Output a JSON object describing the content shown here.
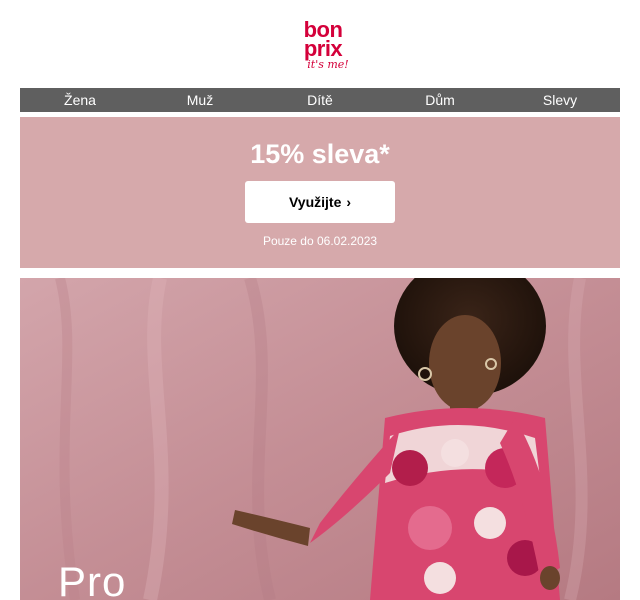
{
  "brand": {
    "logo_line1": "bon",
    "logo_line2": "prix",
    "logo_tagline": "it's me!",
    "color": "#d4003a"
  },
  "nav": {
    "items": [
      {
        "label": "Žena"
      },
      {
        "label": "Muž"
      },
      {
        "label": "Dítě"
      },
      {
        "label": "Dům"
      },
      {
        "label": "Slevy"
      }
    ]
  },
  "promo": {
    "title": "15% sleva*",
    "button_label": "Využijte",
    "button_icon": "chevron-right-icon",
    "validity": "Pouze do 06.02.2023",
    "background": "#d6a9ab"
  },
  "hero": {
    "heading": "Pro",
    "background": "#c48e95"
  }
}
